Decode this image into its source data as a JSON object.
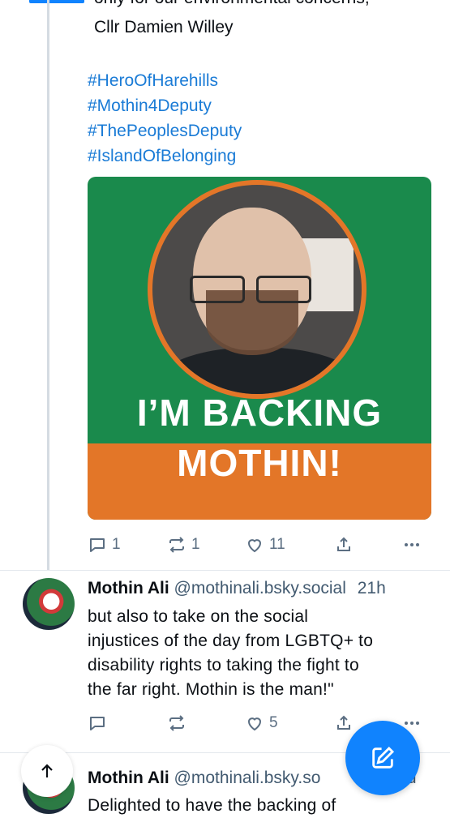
{
  "post1": {
    "cut_line": "only for our environmental concerns,",
    "signature": "Cllr Damien Willey",
    "hashtags": [
      "#HeroOfHarehills",
      "#Mothin4Deputy",
      "#ThePeoplesDeputy",
      "#IslandOfBelonging"
    ],
    "image_text_line1": "I’M BACKING",
    "image_text_line2": "MOTHIN!",
    "replies": "1",
    "reposts": "1",
    "likes": "11"
  },
  "post2": {
    "author": "Mothin Ali",
    "handle": "@mothinali.bsky.social",
    "time": "21h",
    "text_lines": [
      "but also to take on the social",
      "injustices of the day from LGBTQ+ to",
      "disability rights to taking the fight to",
      "the far right. Mothin is the man!\""
    ],
    "likes": "5"
  },
  "post3": {
    "author": "Mothin Ali",
    "handle": "@mothinali.bsky.so",
    "time_fragment": "ld",
    "text": "Delighted to have the backing of"
  },
  "colors": {
    "accent": "#1083fe",
    "hashtag": "#1a7bd6",
    "green": "#1a8a4c",
    "orange": "#e37628"
  }
}
